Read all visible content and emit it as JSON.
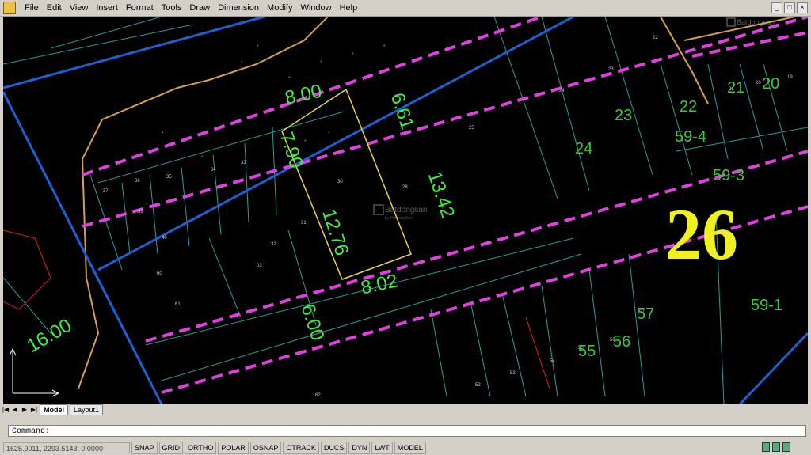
{
  "menu": [
    "File",
    "Edit",
    "View",
    "Insert",
    "Format",
    "Tools",
    "Draw",
    "Dimension",
    "Modify",
    "Window",
    "Help"
  ],
  "watermark": {
    "brand": "Batdongsan",
    "sub": "by PropertyGuru"
  },
  "parcel_numbers": {
    "p26": "26",
    "p24": "24",
    "p23": "23",
    "p22": "22",
    "p21": "21",
    "p20": "20",
    "p59_4": "59-4",
    "p59_3": "59-3",
    "p59_1": "59-1",
    "p57": "57",
    "p56": "56",
    "p55": "55"
  },
  "dimensions": {
    "d8_00": "8.00",
    "d6_61": "6.61",
    "d7_90": "7.90",
    "d13_42": "13.42",
    "d12_76": "12.76",
    "d8_02": "8.02",
    "d6_00": "6.00",
    "d16_00": "16.00"
  },
  "tabs": {
    "model": "Model",
    "layout1": "Layout1"
  },
  "command_label": "Command:",
  "coordinates": "1625.9011, 2293.5143, 0.0000",
  "status_buttons": [
    "SNAP",
    "GRID",
    "ORTHO",
    "POLAR",
    "OSNAP",
    "OTRACK",
    "DUCS",
    "DYN",
    "LWT",
    "MODEL"
  ]
}
